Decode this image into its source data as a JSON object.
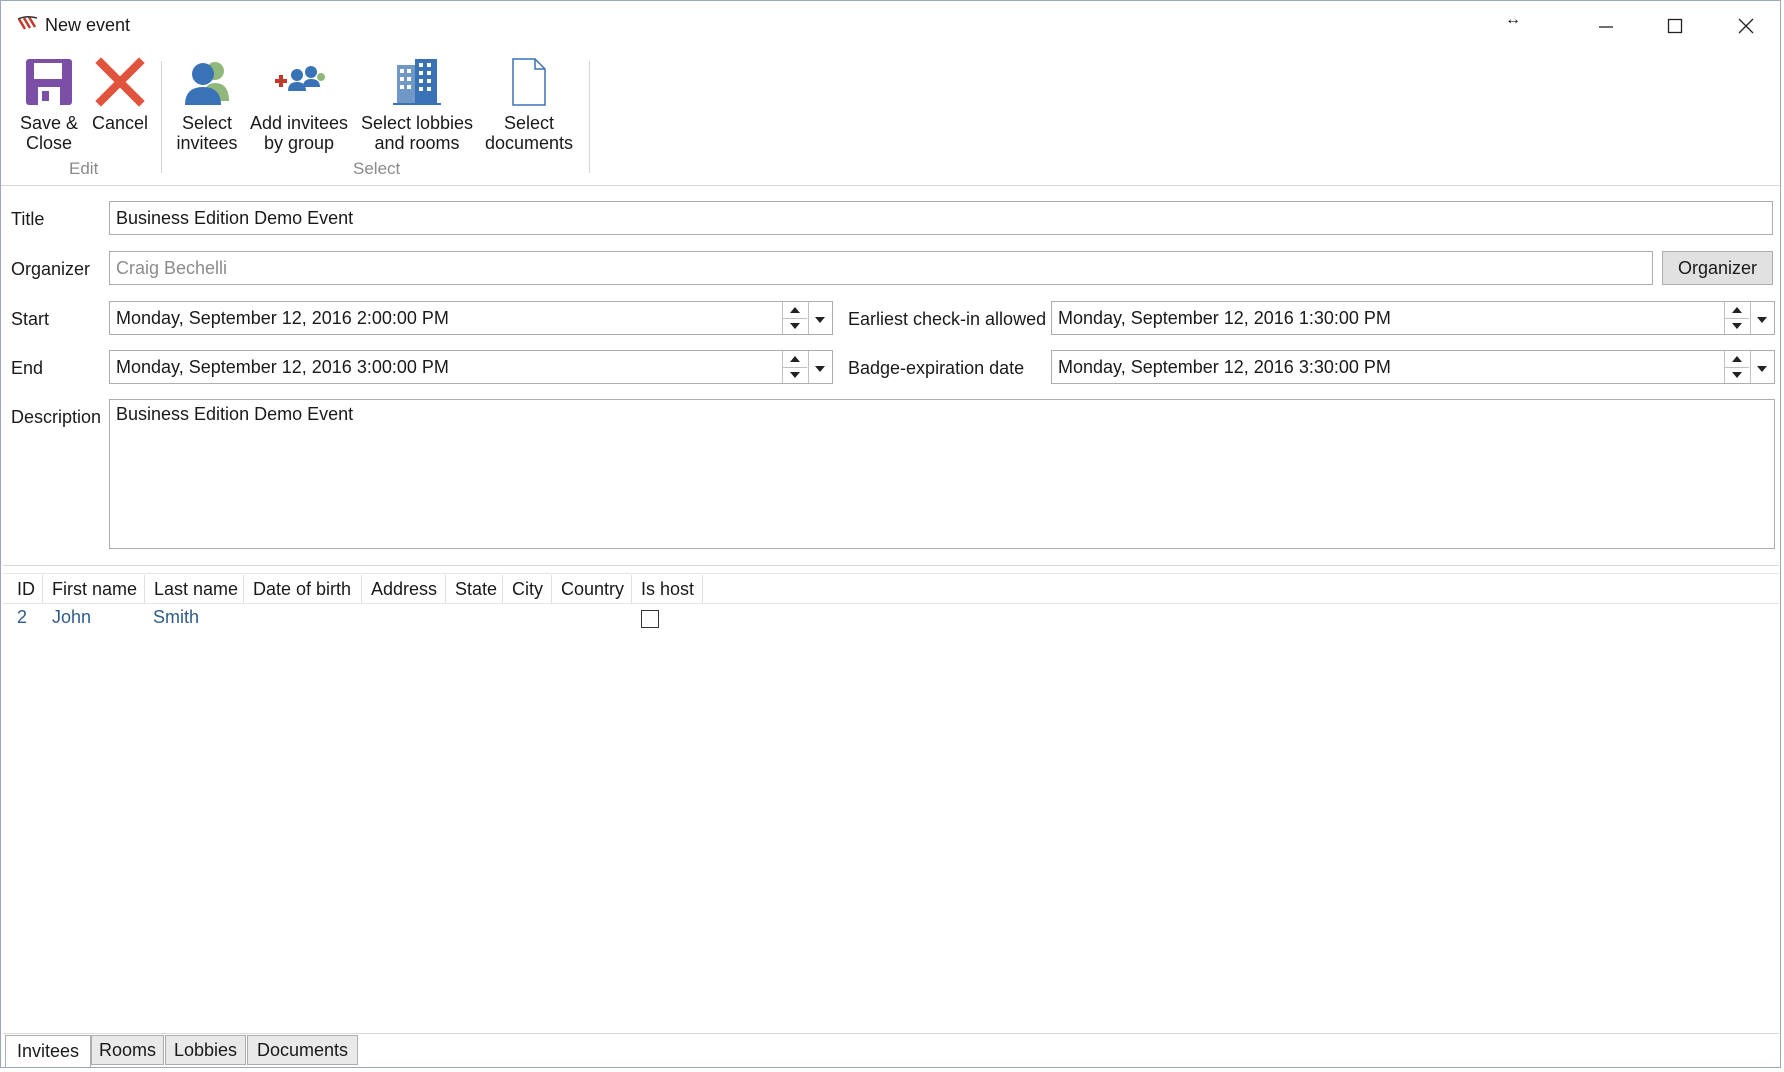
{
  "window": {
    "title": "New event",
    "resize_glyph": "↔"
  },
  "ribbon": {
    "buttons": [
      {
        "label": "Save &\nClose",
        "icon": "floppy-disk-icon"
      },
      {
        "label": "Cancel",
        "icon": "red-x-icon"
      },
      {
        "label": "Select\ninvitees",
        "icon": "person-icon"
      },
      {
        "label": "Add invitees\nby group",
        "icon": "add-group-icon"
      },
      {
        "label": "Select lobbies\nand rooms",
        "icon": "building-icon"
      },
      {
        "label": "Select\ndocuments",
        "icon": "document-icon"
      }
    ],
    "groups": {
      "edit": "Edit",
      "select": "Select"
    }
  },
  "form": {
    "title_label": "Title",
    "title_value": "Business Edition Demo Event",
    "organizer_label": "Organizer",
    "organizer_value": "Craig  Bechelli",
    "organizer_button": "Organizer",
    "start_label": "Start",
    "start_value": "Monday, September 12, 2016 2:00:00 PM",
    "end_label": "End",
    "end_value": "Monday, September 12, 2016 3:00:00 PM",
    "checkin_label": "Earliest check-in allowed",
    "checkin_value": "Monday, September 12, 2016 1:30:00 PM",
    "badge_label": "Badge-expiration date",
    "badge_value": "Monday, September 12, 2016 3:30:00 PM",
    "description_label": "Description",
    "description_value": "Business Edition Demo Event"
  },
  "grid": {
    "columns": [
      "ID",
      "First name",
      "Last name",
      "Date of birth",
      "Address",
      "State",
      "City",
      "Country",
      "Is host"
    ],
    "rows": [
      {
        "id": "2",
        "first_name": "John",
        "last_name": "Smith",
        "is_host": false
      }
    ]
  },
  "tabs": [
    "Invitees",
    "Rooms",
    "Lobbies",
    "Documents"
  ],
  "colors": {
    "accent_purple": "#7b4fa6",
    "cancel_red": "#e0533d",
    "link_blue": "#2e5c8a"
  }
}
